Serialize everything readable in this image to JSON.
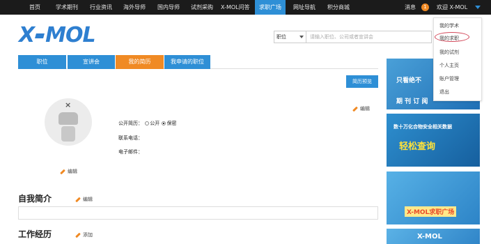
{
  "topnav": {
    "items": [
      "首页",
      "学术期刊",
      "行业资讯",
      "海外导师",
      "国内导师",
      "试剂采购",
      "X-MOL问答",
      "求职广场",
      "网址导航",
      "积分商城"
    ],
    "active_index": 7,
    "messages_label": "消息",
    "notice_count": "1",
    "welcome": "欢迎 X-MOL"
  },
  "logo": {
    "text_left": "X",
    "text_right": "MOL"
  },
  "search": {
    "select_value": "职位",
    "placeholder": "请输入职位、公司或者宣讲会"
  },
  "user_menu": {
    "items": [
      "我的学术",
      "我的求职",
      "我的试剂",
      "个人主页",
      "账户管理",
      "退出"
    ],
    "highlighted_index": 1
  },
  "tabs": [
    {
      "label": "职位"
    },
    {
      "label": "宣讲会"
    },
    {
      "label": "我的简历"
    },
    {
      "label": "我申请的职位"
    }
  ],
  "active_tab": 2,
  "resume_preview_label": "简历预览",
  "profile": {
    "edit_label": "编辑",
    "avatar_edit_label": "编辑",
    "public_label": "公开简历：",
    "public_option": "公开",
    "private_option": "保密",
    "phone_label": "联系电话：",
    "email_label": "电子邮件："
  },
  "intro": {
    "title": "自我简介",
    "edit_label": "编辑"
  },
  "work": {
    "title": "工作经历",
    "add_label": "添加"
  },
  "ads": {
    "ad1_line1": "只看绝不",
    "ad1_line2": "期 刊 订 阅",
    "ad2_line1": "数十万化合物安全相关数据",
    "ad2_line2": "轻松查询",
    "ad3_line1": "X-MOL求职广场",
    "ad4_line1": "X-MOL"
  },
  "colors": {
    "primary": "#2e8fd6",
    "accent": "#f08a24",
    "nav_bg": "#1b1b1b"
  }
}
